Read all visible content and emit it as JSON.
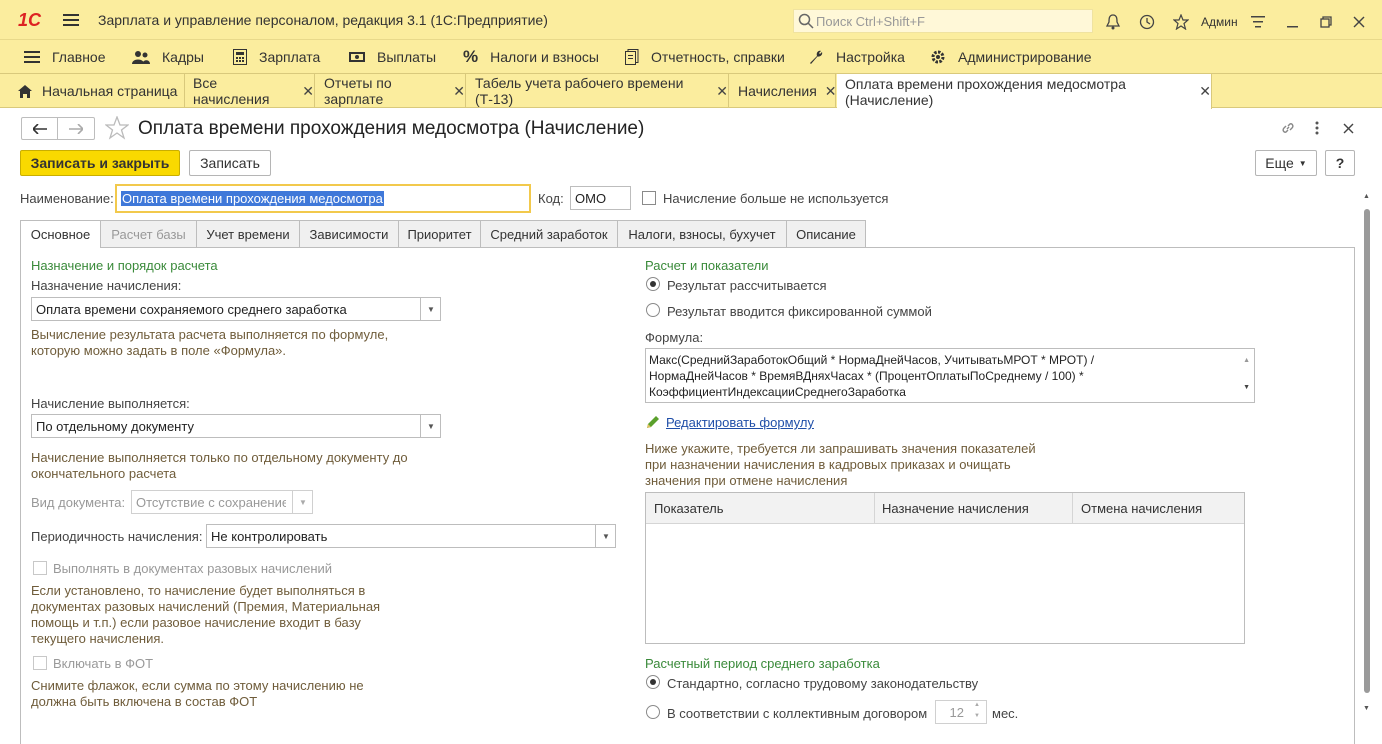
{
  "titlebar": {
    "logo": "1C",
    "title": "Зарплата и управление персоналом, редакция 3.1  (1С:Предприятие)",
    "search_placeholder": "Поиск Ctrl+Shift+F",
    "user": "Админ"
  },
  "menu": [
    {
      "label": "Главное",
      "icon": "hamburger-icon"
    },
    {
      "label": "Кадры",
      "icon": "people-icon"
    },
    {
      "label": "Зарплата",
      "icon": "calculator-icon"
    },
    {
      "label": "Выплаты",
      "icon": "money-icon"
    },
    {
      "label": "Налоги и взносы",
      "icon": "percent-icon"
    },
    {
      "label": "Отчетность, справки",
      "icon": "report-icon"
    },
    {
      "label": "Настройка",
      "icon": "wrench-icon"
    },
    {
      "label": "Администрирование",
      "icon": "gear-icon"
    }
  ],
  "tabs": [
    {
      "label": "Начальная страница"
    },
    {
      "label": "Все начисления"
    },
    {
      "label": "Отчеты по зарплате"
    },
    {
      "label": "Табель учета рабочего времени (Т-13)"
    },
    {
      "label": "Начисления"
    },
    {
      "label": "Оплата времени прохождения медосмотра (Начисление)"
    }
  ],
  "form": {
    "title": "Оплата времени прохождения медосмотра (Начисление)",
    "save_close": "Записать и закрыть",
    "save": "Записать",
    "more": "Еще",
    "help": "?",
    "name_label": "Наименование:",
    "name_value": "Оплата времени прохождения медосмотра",
    "code_label": "Код:",
    "code_value": "ОМО",
    "unused_label": "Начисление больше не используется"
  },
  "form_tabs": [
    {
      "label": "Основное"
    },
    {
      "label": "Расчет базы"
    },
    {
      "label": "Учет времени"
    },
    {
      "label": "Зависимости"
    },
    {
      "label": "Приоритет"
    },
    {
      "label": "Средний заработок"
    },
    {
      "label": "Налоги, взносы, бухучет"
    },
    {
      "label": "Описание"
    }
  ],
  "left": {
    "section_title": "Назначение и порядок расчета",
    "purpose_label": "Назначение начисления:",
    "purpose_value": "Оплата времени сохраняемого среднего заработка",
    "purpose_hint1": "Вычисление результата расчета выполняется по формуле,",
    "purpose_hint2": "которую можно задать в поле «Формула».",
    "exec_label": "Начисление выполняется:",
    "exec_value": "По отдельному документу",
    "exec_hint1": "Начисление выполняется только по отдельному документу до",
    "exec_hint2": "окончательного расчета",
    "doc_type_label": "Вид документа:",
    "doc_type_value": "Отсутствие с сохранением",
    "period_label": "Периодичность начисления:",
    "period_value": "Не контролировать",
    "onetime_label": "Выполнять в документах разовых начислений",
    "onetime_hint1": "Если установлено, то начисление будет выполняться в",
    "onetime_hint2": "документах разовых начислений (Премия, Материальная",
    "onetime_hint3": "помощь и т.п.) если разовое начисление входит в базу",
    "onetime_hint4": "текущего начисления.",
    "fot_label": "Включать в ФОТ",
    "fot_hint1": "Снимите флажок, если сумма по этому начислению не",
    "fot_hint2": "должна быть включена в состав ФОТ"
  },
  "right": {
    "section_title": "Расчет и показатели",
    "radio1": "Результат рассчитывается",
    "radio2": "Результат вводится фиксированной суммой",
    "formula_label": "Формула:",
    "formula_line1": "Макс(СреднийЗаработокОбщий * НормаДнейЧасов, УчитыватьМРОТ * МРОТ) /",
    "formula_line2": "НормаДнейЧасов * ВремяВДняхЧасах * (ПроцентОплатыПоСреднему / 100) *",
    "formula_line3": "КоэффициентИндексацииСреднегоЗаработка",
    "edit_formula": "Редактировать формулу",
    "hint1": "Ниже укажите, требуется ли запрашивать значения показателей",
    "hint2": "при назначении начисления в кадровых приказах и очищать",
    "hint3": "значения при отмене начисления",
    "table_headers": [
      "Показатель",
      "Назначение начисления",
      "Отмена начисления"
    ],
    "avg_title": "Расчетный период среднего заработка",
    "avg_radio1": "Стандартно, согласно трудовому законодательству",
    "avg_radio2": "В соответствии с коллективным договором",
    "months_value": "12",
    "months_unit": "мес."
  },
  "colors": {
    "accent_yellow": "#fbed9e",
    "button_yellow": "#f9d900",
    "section_green": "#3a8a3a",
    "hint_brown": "#6f5c3a"
  }
}
